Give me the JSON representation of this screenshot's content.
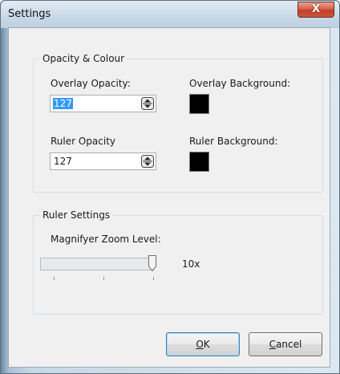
{
  "window": {
    "title": "Settings",
    "close_glyph": "X"
  },
  "opacity_group": {
    "title": "Opacity & Colour",
    "overlay_opacity_label": "Overlay Opacity:",
    "overlay_opacity_value": "127",
    "overlay_background_label": "Overlay Background:",
    "overlay_background_color": "#000000",
    "ruler_opacity_label": "Ruler Opacity",
    "ruler_opacity_value": "127",
    "ruler_background_label": "Ruler Background:",
    "ruler_background_color": "#000000"
  },
  "ruler_group": {
    "title": "Ruler Settings",
    "zoom_label": "Magnifyer Zoom Level:",
    "zoom_value": "10x"
  },
  "buttons": {
    "ok_mnemonic": "O",
    "ok_rest": "K",
    "cancel_mnemonic": "C",
    "cancel_rest": "ancel"
  }
}
